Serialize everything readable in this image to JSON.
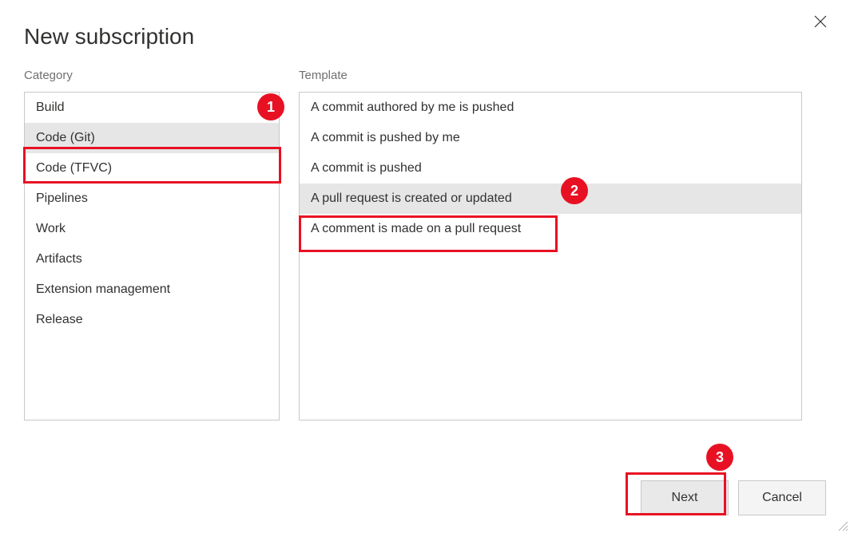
{
  "dialog": {
    "title": "New subscription",
    "category_label": "Category",
    "template_label": "Template"
  },
  "categories": {
    "items": [
      {
        "label": "Build",
        "selected": false
      },
      {
        "label": "Code (Git)",
        "selected": true
      },
      {
        "label": "Code (TFVC)",
        "selected": false
      },
      {
        "label": "Pipelines",
        "selected": false
      },
      {
        "label": "Work",
        "selected": false
      },
      {
        "label": "Artifacts",
        "selected": false
      },
      {
        "label": "Extension management",
        "selected": false
      },
      {
        "label": "Release",
        "selected": false
      }
    ]
  },
  "templates": {
    "items": [
      {
        "label": "A commit authored by me is pushed",
        "selected": false
      },
      {
        "label": "A commit is pushed by me",
        "selected": false
      },
      {
        "label": "A commit is pushed",
        "selected": false
      },
      {
        "label": "A pull request is created or updated",
        "selected": true
      },
      {
        "label": "A comment is made on a pull request",
        "selected": false
      }
    ]
  },
  "buttons": {
    "next": "Next",
    "cancel": "Cancel"
  },
  "annotations": {
    "one": "1",
    "two": "2",
    "three": "3"
  }
}
